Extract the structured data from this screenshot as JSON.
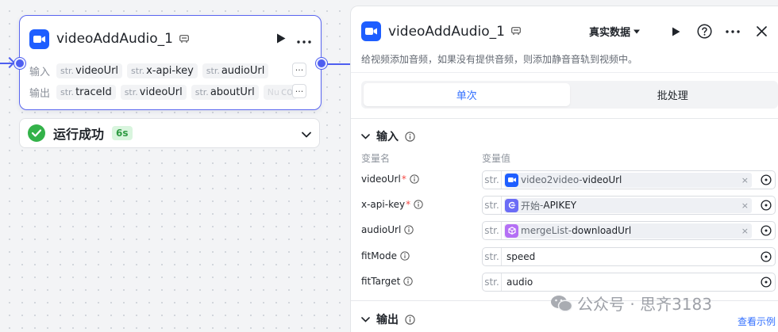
{
  "node": {
    "title": "videoAddAudio_1",
    "input_label": "输入",
    "output_label": "输出",
    "inputs": [
      {
        "type": "str.",
        "name": "videoUrl"
      },
      {
        "type": "str.",
        "name": "x-api-key"
      },
      {
        "type": "str.",
        "name": "audioUrl"
      }
    ],
    "outputs": [
      {
        "type": "str.",
        "name": "traceId"
      },
      {
        "type": "str.",
        "name": "videoUrl"
      },
      {
        "type": "str.",
        "name": "aboutUrl"
      },
      {
        "type": "Nu",
        "name": "co"
      }
    ],
    "more_glyph": "···"
  },
  "status": {
    "text": "运行成功",
    "duration": "6s"
  },
  "panel": {
    "title": "videoAddAudio_1",
    "env_label": "真实数据",
    "description": "给视频添加音频，如果没有提供音频，则添加静音音轨到视频中。",
    "tabs": [
      {
        "label": "单次",
        "active": true
      },
      {
        "label": "批处理",
        "active": false
      }
    ],
    "input_section": "输入",
    "col_name": "变量名",
    "col_value": "变量值",
    "variables": [
      {
        "name": "videoUrl",
        "required": true,
        "type": "str.",
        "kind": "ref",
        "icon": "video-icon",
        "color": "#1e5eff",
        "source": "video2video",
        "ref_var": "videoUrl"
      },
      {
        "name": "x-api-key",
        "required": true,
        "type": "str.",
        "kind": "ref",
        "icon": "start-icon",
        "color": "#6b6cf6",
        "source": "开始",
        "ref_var": "APIKEY"
      },
      {
        "name": "audioUrl",
        "required": false,
        "type": "str.",
        "kind": "ref",
        "icon": "cube-icon",
        "color": "#b46ff5",
        "source": "mergeList",
        "ref_var": "downloadUrl"
      },
      {
        "name": "fitMode",
        "required": false,
        "type": "str.",
        "kind": "value",
        "value": "speed"
      },
      {
        "name": "fitTarget",
        "required": false,
        "type": "str.",
        "kind": "value",
        "value": "audio"
      }
    ],
    "ref_sep": " - ",
    "clear_glyph": "×",
    "output_section": "输出",
    "example_link": "查看示例"
  },
  "watermark": "公众号 · 思齐3183"
}
